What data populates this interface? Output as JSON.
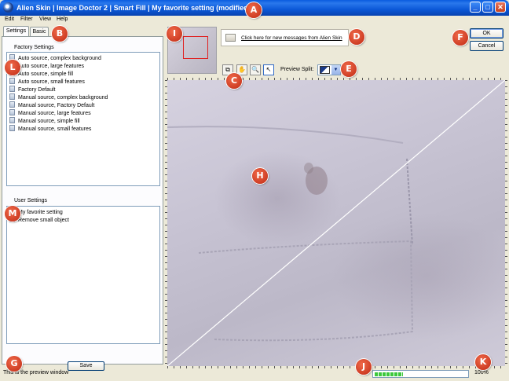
{
  "window": {
    "title": "Alien Skin | Image Doctor 2 | Smart Fill | My favorite setting (modified)",
    "minimize": "_",
    "maximize": "□",
    "close": "✕"
  },
  "menu": [
    "Edit",
    "Filter",
    "View",
    "Help"
  ],
  "tabs": [
    "Settings",
    "Basic"
  ],
  "factory_settings": {
    "label": "Factory Settings",
    "items": [
      "Auto source, complex background",
      "Auto source, large features",
      "Auto source, simple fill",
      "Auto source, small features",
      "Factory Default",
      "Manual source, complex background",
      "Manual source, Factory Default",
      "Manual source, large features",
      "Manual source, simple fill",
      "Manual source, small features"
    ]
  },
  "user_settings": {
    "label": "User Settings",
    "items": [
      "My favorite setting",
      "Remove small object"
    ]
  },
  "save_label": "Save",
  "message_link": "Click here for new messages from Alien Skin",
  "ok_label": "OK",
  "cancel_label": "Cancel",
  "tools": {
    "compare": "⧉",
    "hand": "✋",
    "zoom": "🔍",
    "arrow": "↖"
  },
  "preview_split_label": "Preview Split:",
  "status_text": "This is the preview window",
  "progress_fraction": 0.3,
  "zoom_level": "100%",
  "markers": [
    "A",
    "B",
    "C",
    "D",
    "E",
    "F",
    "G",
    "H",
    "I",
    "J",
    "K",
    "L",
    "M"
  ],
  "colors": {
    "titlebar": "#0a5ce0",
    "marker": "#d83a20",
    "progress": "#3cc83c"
  }
}
